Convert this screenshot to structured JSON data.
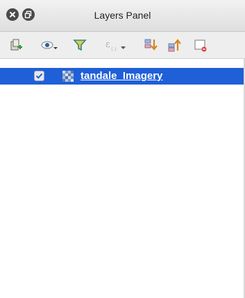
{
  "window": {
    "title": "Layers Panel",
    "buttons": [
      "close-icon",
      "restore-icon"
    ]
  },
  "toolbar": {
    "icons": [
      "add-group-icon",
      "visibility-eye-icon",
      "filter-icon",
      "filter-expression-icon",
      "expand-all-icon",
      "collapse-all-icon",
      "remove-layer-icon"
    ]
  },
  "layers": [
    {
      "name": "tandale_Imagery",
      "checked": true,
      "selected": true,
      "type": "raster"
    }
  ],
  "colors": {
    "selection": "#1f5fd8",
    "titlebar": "#e6e6e6",
    "toolbar": "#eeeeee"
  }
}
